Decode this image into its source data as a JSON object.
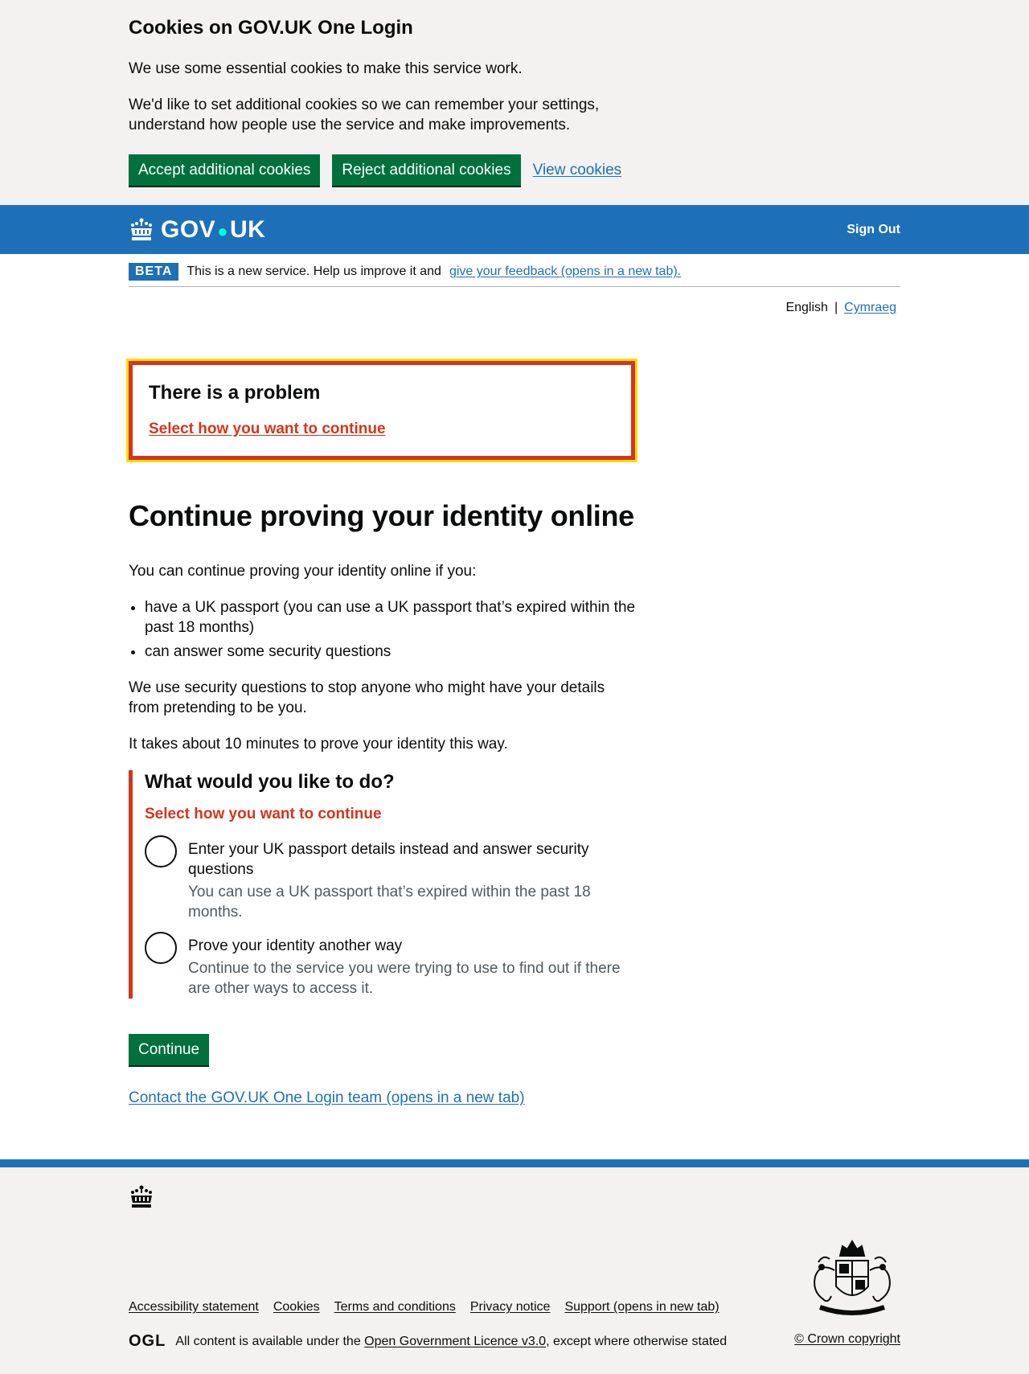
{
  "cookie_banner": {
    "title": "Cookies on GOV.UK One Login",
    "text1": "We use some essential cookies to make this service work.",
    "text2": "We'd like to set additional cookies so we can remember your settings, understand how people use the service and make improvements.",
    "accept_label": "Accept additional cookies",
    "reject_label": "Reject additional cookies",
    "view_label": "View cookies"
  },
  "header": {
    "logo_left": "GOV",
    "logo_right": "UK",
    "sign_out": "Sign Out"
  },
  "beta": {
    "tag": "BETA",
    "text": "This is a new service. Help us improve it and",
    "link": "give your feedback (opens in a new tab)."
  },
  "language": {
    "current": "English",
    "separator": "|",
    "alternate": "Cymraeg"
  },
  "error_summary": {
    "title": "There is a problem",
    "link": "Select how you want to continue"
  },
  "main": {
    "title": "Continue proving your identity online",
    "intro": "You can continue proving your identity online if you:",
    "bullets": [
      "have a UK passport (you can use a UK passport that’s expired within the past 18 months)",
      "can answer some security questions"
    ],
    "para1": "We use security questions to stop anyone who might have your details from pretending to be you.",
    "para2": "It takes about 10 minutes to prove your identity this way."
  },
  "form": {
    "legend": "What would you like to do?",
    "error": "Select how you want to continue",
    "options": [
      {
        "label": "Enter your UK passport details instead and answer security questions",
        "hint": "You can use a UK passport that’s expired within the past 18 months."
      },
      {
        "label": "Prove your identity another way",
        "hint": "Continue to the service you were trying to use to find out if there are other ways to access it."
      }
    ],
    "continue_label": "Continue",
    "contact_link": "Contact the GOV.UK One Login team (opens in a new tab)"
  },
  "footer": {
    "links": [
      "Accessibility statement",
      "Cookies",
      "Terms and conditions",
      "Privacy notice",
      "Support (opens in new tab)"
    ],
    "ogl_logo": "OGL",
    "licence_pre": "All content is available under the",
    "licence_link": "Open Government Licence v3.0",
    "licence_post": ", except where otherwise stated",
    "copyright": "© Crown copyright"
  },
  "colors": {
    "brand_blue": "#1d70b8",
    "button_green": "#00703c",
    "error_red": "#d4351c",
    "focus_yellow": "#ffdd00"
  }
}
